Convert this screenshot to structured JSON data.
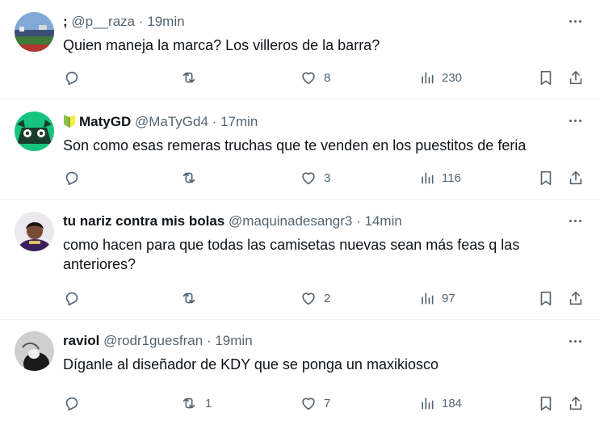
{
  "replies": [
    {
      "name": ";",
      "handle": "@p__raza",
      "separator": "·",
      "time": "19min",
      "text": "Quien maneja la marca? Los villeros de la barra?",
      "stats": {
        "replies": "",
        "reposts": "",
        "likes": "8",
        "views": "230"
      }
    },
    {
      "name": "MatyGD",
      "handle": "@MaTyGd4",
      "separator": "·",
      "time": "17min",
      "text": "Son como esas remeras truchas que te venden en los puestitos de feria",
      "stats": {
        "replies": "",
        "reposts": "",
        "likes": "3",
        "views": "116"
      }
    },
    {
      "name": "tu nariz contra mis bolas",
      "handle": "@maquinadesangr3",
      "separator": "·",
      "time": "14min",
      "text": "como hacen para que todas las camisetas nuevas sean más feas q las anteriores?",
      "stats": {
        "replies": "",
        "reposts": "",
        "likes": "2",
        "views": "97"
      }
    },
    {
      "name": "raviol",
      "handle": "@rodr1guesfran",
      "separator": "·",
      "time": "19min",
      "text": "Díganle al diseñador de KDY que se ponga un maxikiosco",
      "stats": {
        "replies": "",
        "reposts": "1",
        "likes": "7",
        "views": "184"
      }
    }
  ],
  "icons": [
    "reply-icon",
    "repost-icon",
    "like-icon",
    "views-icon",
    "bookmark-icon",
    "share-icon",
    "more-icon"
  ],
  "colors": {
    "text": "#0f1419",
    "secondary": "#536471",
    "divider": "#eff3f4"
  }
}
